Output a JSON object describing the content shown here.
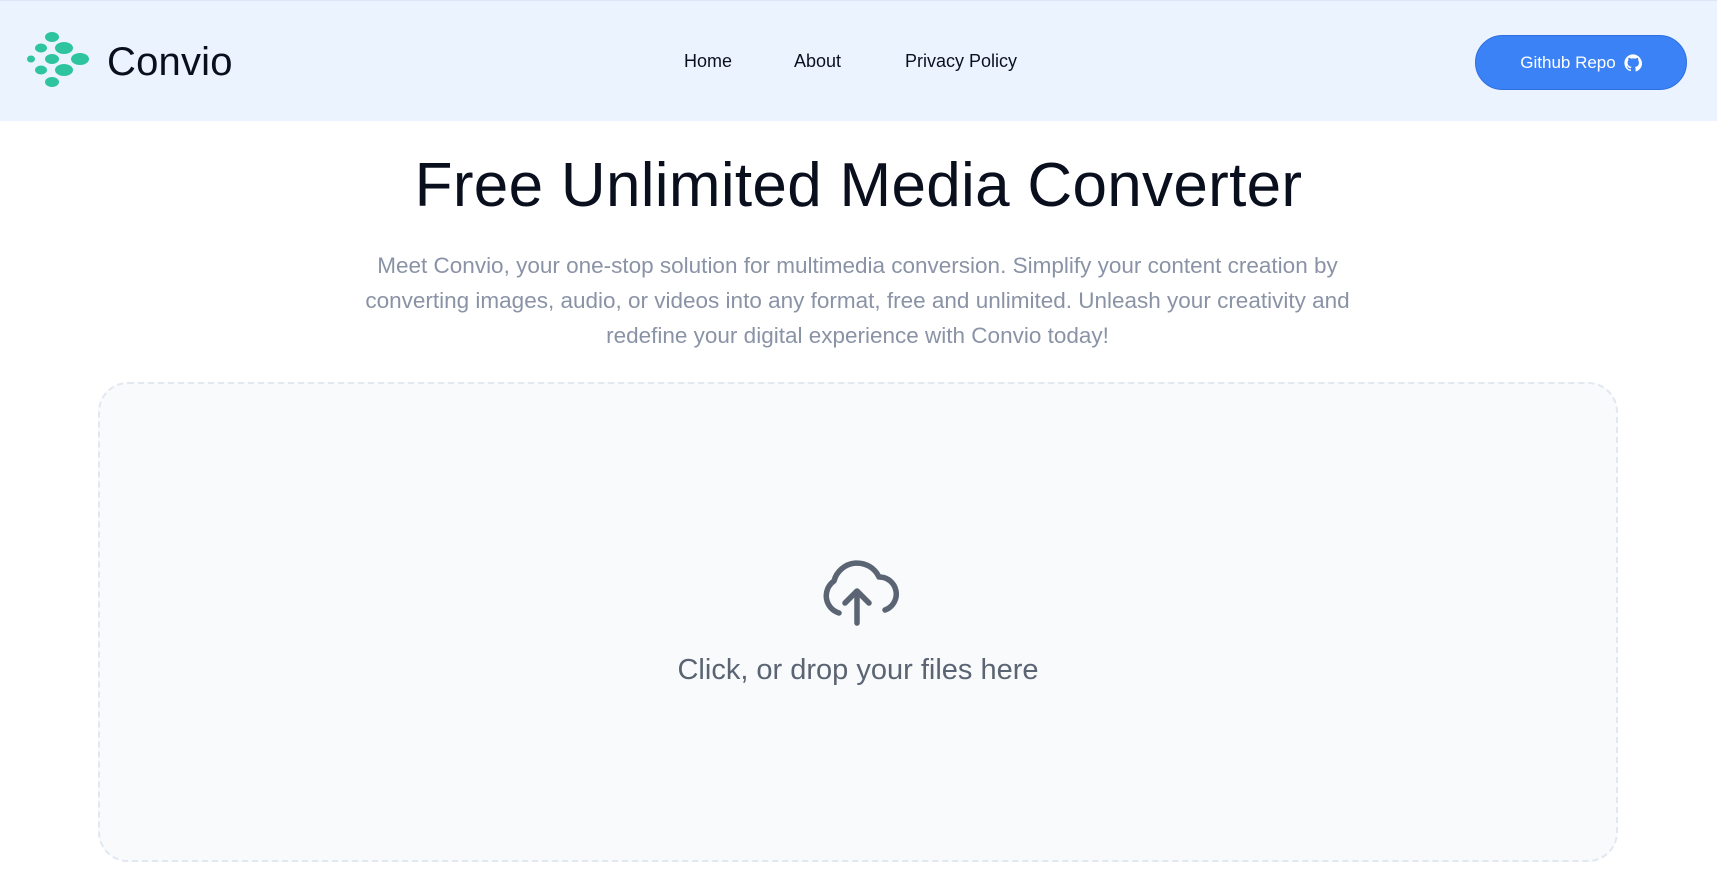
{
  "brand": {
    "name": "Convio",
    "logo_icon": "dots-logo-icon",
    "accent_color": "#2ec4a0"
  },
  "nav": {
    "items": [
      {
        "label": "Home"
      },
      {
        "label": "About"
      },
      {
        "label": "Privacy Policy"
      }
    ],
    "github_button": {
      "label": "Github Repo",
      "icon": "github-icon",
      "color": "#3b82f6"
    }
  },
  "hero": {
    "title": "Free Unlimited Media Converter",
    "description": "Meet Convio, your one-stop solution for multimedia conversion. Simplify your content creation by converting images, audio, or videos into any format, free and unlimited. Unleash your creativity and redefine your digital experience with Convio today!"
  },
  "dropzone": {
    "icon": "cloud-upload-icon",
    "label": "Click, or drop your files here"
  }
}
